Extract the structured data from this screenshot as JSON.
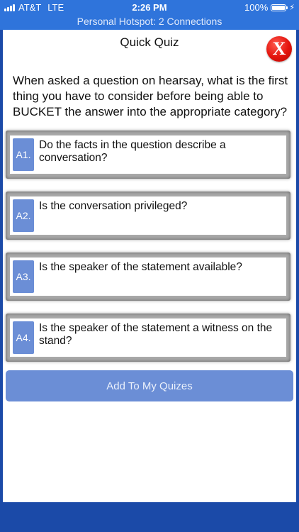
{
  "status_bar": {
    "carrier": "AT&T",
    "network": "LTE",
    "time": "2:26 PM",
    "battery_percent": "100%",
    "battery_level": 1.0,
    "charging_icon": "bolt-icon"
  },
  "hotspot": {
    "text": "Personal Hotspot: 2 Connections"
  },
  "quiz": {
    "title": "Quick Quiz",
    "close_label": "X",
    "question": "When asked a question on hearsay, what is the first thing you have to consider before being able to BUCKET the answer into the appropriate category?",
    "answers": [
      {
        "label": "A1.",
        "text": "Do the facts in the question describe a conversation?"
      },
      {
        "label": "A2.",
        "text": "Is the conversation privileged?"
      },
      {
        "label": "A3.",
        "text": "Is the speaker of the statement available?"
      },
      {
        "label": "A4.",
        "text": "Is the speaker of the statement a witness on the stand?"
      }
    ],
    "add_button_label": "Add To My Quizes"
  },
  "colors": {
    "bar_blue": "#2f74db",
    "frame_blue": "#1b4aa8",
    "accent_blue": "#6b8ed6",
    "close_red": "#e3130c"
  }
}
